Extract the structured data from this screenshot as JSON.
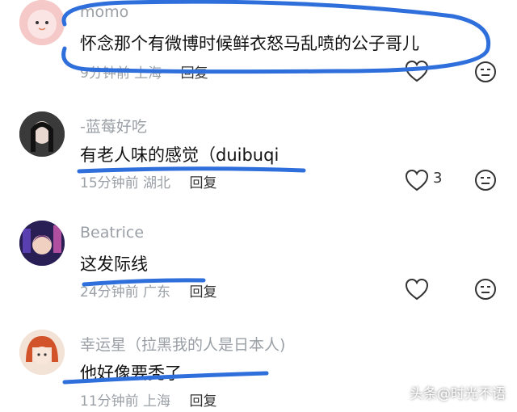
{
  "comments": [
    {
      "username": "momo",
      "text": "怀念那个有微博时候鲜衣怒马乱喷的公子哥儿",
      "time": "9分钟前",
      "location": "上海",
      "reply_label": "回复",
      "likes": ""
    },
    {
      "username": "-蓝莓好吃",
      "text": "有老人味的感觉（duibuqi",
      "time": "15分钟前",
      "location": "湖北",
      "reply_label": "回复",
      "likes": "3"
    },
    {
      "username": "Beatrice",
      "text": "这发际线",
      "time": "24分钟前",
      "location": "广东",
      "reply_label": "回复",
      "likes": ""
    },
    {
      "username": "幸运星（拉黑我的人是日本人)",
      "text": "他好像要秃了",
      "time": "11分钟前",
      "location": "上海",
      "reply_label": "回复",
      "likes": ""
    }
  ],
  "watermark": "头条@时光不语",
  "colors": {
    "annotation_blue": "#2f6fdc",
    "meta_gray": "#9aa0a6"
  }
}
